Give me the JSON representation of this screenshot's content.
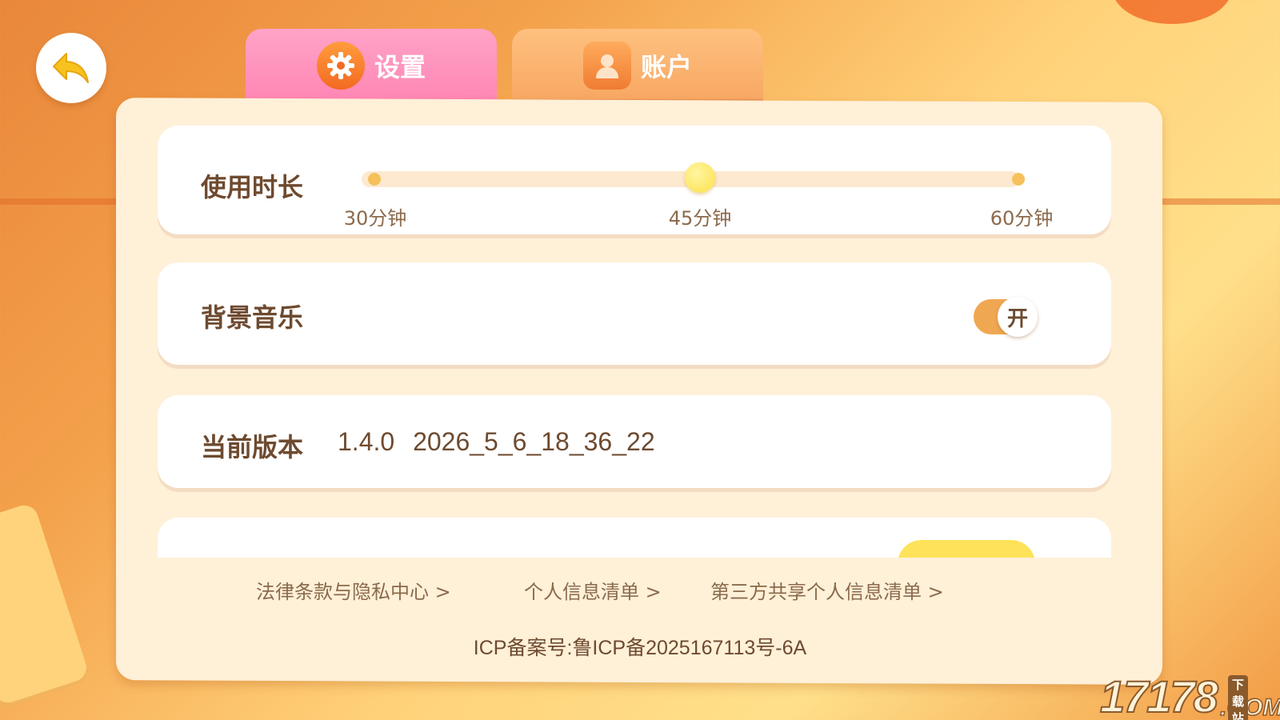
{
  "tabs": [
    {
      "label": "设置",
      "icon": "gear-icon",
      "active": true
    },
    {
      "label": "账户",
      "icon": "user-icon",
      "active": false
    }
  ],
  "back_icon": "back-arrow-icon",
  "usage_duration": {
    "label": "使用时长",
    "ticks": [
      "30分钟",
      "45分钟",
      "60分钟"
    ],
    "selected": "45分钟"
  },
  "background_music": {
    "label": "背景音乐",
    "toggle_text": "开",
    "on": true
  },
  "version": {
    "label": "当前版本",
    "value": "1.4.0   2026_5_6_18_36_22"
  },
  "footer": {
    "links": [
      "法律条款与隐私中心 >",
      "个人信息清单 >",
      "第三方共享个人信息清单 >"
    ],
    "icp": "ICP备案号:鲁ICP备2025167113号-6A"
  },
  "watermark": {
    "number": "17178",
    "domain": ".COM",
    "tag": "下载站"
  },
  "colors": {
    "accent_pink": "#ff86b4",
    "accent_orange": "#f7a762",
    "text_brown": "#6e4a2f",
    "slider_knob": "#fde048",
    "panel": "#fff0d8"
  }
}
